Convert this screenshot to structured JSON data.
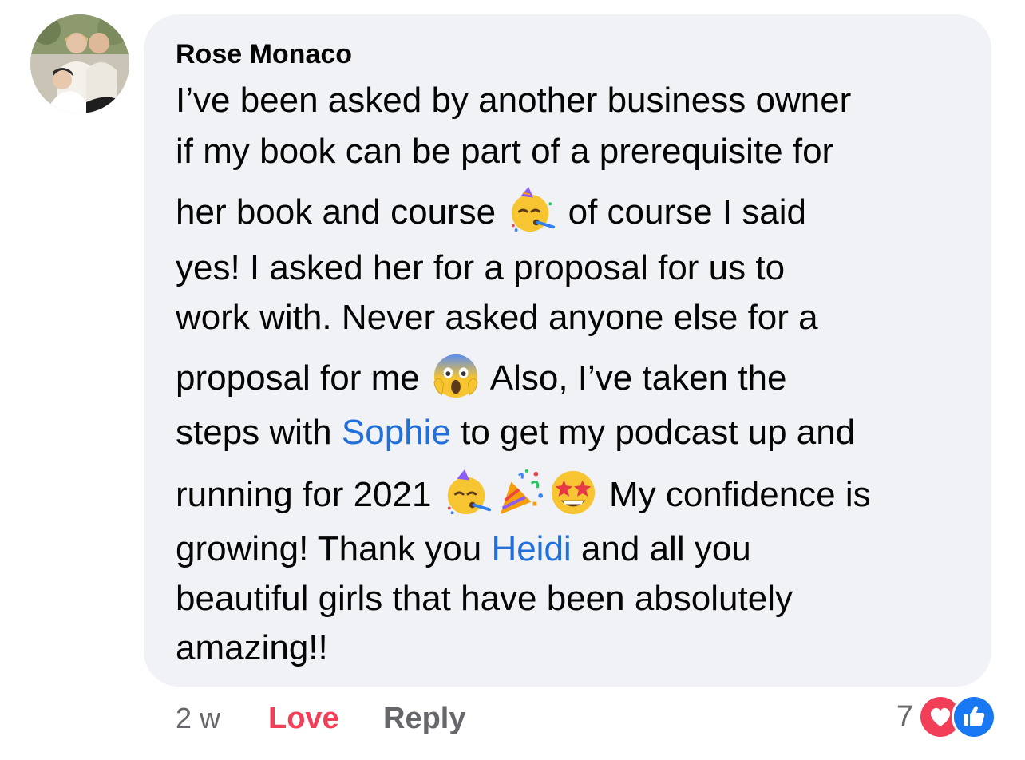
{
  "comment": {
    "author": "Rose Monaco",
    "lines": [
      "I’ve been asked by another business owner",
      "if my book can be part of a prerequisite for",
      "her book and course",
      "of course I said",
      "yes! I asked her for a proposal for us to",
      "work with. Never asked anyone else for a",
      "proposal for me",
      "Also, I’ve taken the",
      "steps with",
      "Sophie",
      "to get my podcast up and",
      "running for 2021",
      "My confidence is",
      "growing! Thank you",
      "Heidi",
      "and all you",
      "beautiful girls that have been absolutely",
      "amazing!!"
    ],
    "emojis": [
      "partying-face-emoji",
      "face-screaming-in-fear-emoji",
      "party-popper-emoji",
      "star-struck-emoji"
    ],
    "mention_color": "#216fdb"
  },
  "actions": {
    "time": "2 w",
    "love_label": "Love",
    "reply_label": "Reply"
  },
  "reactions": {
    "count": "7",
    "icons": [
      "love-reaction-icon",
      "like-reaction-icon"
    ],
    "love_color": "#f33e58",
    "like_color": "#1877f2"
  },
  "colors": {
    "bubble": "#f0f2f5",
    "text": "#050505",
    "secondary": "#65676b"
  }
}
